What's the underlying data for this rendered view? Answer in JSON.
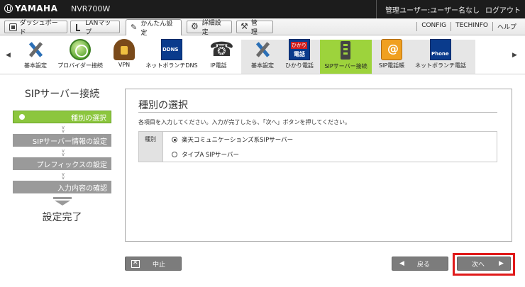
{
  "header": {
    "brand": "YAMAHA",
    "model": "NVR700W",
    "user": "管理ユーザー:ユーザー名なし",
    "logout": "ログアウト"
  },
  "tabs": [
    {
      "label": "ダッシュボード",
      "icon": "dashboard-icon"
    },
    {
      "label": "LANマップ",
      "icon": "lan-map-icon"
    },
    {
      "label": "かんたん設定",
      "icon": "wizard-icon",
      "active": true
    },
    {
      "label": "詳細設定",
      "icon": "gear-icon"
    },
    {
      "label": "管　理",
      "icon": "wrench-icon"
    }
  ],
  "tab_links": [
    "CONFIG",
    "TECHINFO",
    "ヘルプ"
  ],
  "toolbar": {
    "prev_arrow": "◀",
    "next_arrow": "▶",
    "items": [
      {
        "label": "基本設定",
        "icon": "tools-icon"
      },
      {
        "label": "プロバイダー接続",
        "icon": "globe-icon"
      },
      {
        "label": "VPN",
        "icon": "vpn-icon"
      },
      {
        "label": "ネットボランチDNS",
        "icon": "ddns-icon",
        "icon_text": "DDNS Service"
      },
      {
        "label": "IP電話",
        "icon": "phone-icon"
      },
      {
        "label": "基本設定",
        "icon": "tools-icon"
      },
      {
        "label": "ひかり電話",
        "icon": "hikari-phone-icon"
      },
      {
        "label": "SIPサーバー接続",
        "icon": "sip-server-icon",
        "selected": true
      },
      {
        "label": "SIP電話帳",
        "icon": "address-book-icon"
      },
      {
        "label": "ネットボランチ電話",
        "icon": "net-phone-icon"
      }
    ]
  },
  "sidebar": {
    "title": "SIPサーバー接続",
    "steps": [
      {
        "label": "種別の選択",
        "active": true
      },
      {
        "label": "SIPサーバー情報の設定"
      },
      {
        "label": "プレフィックスの設定"
      },
      {
        "label": "入力内容の確認"
      }
    ],
    "done": "設定完了"
  },
  "main": {
    "title": "種別の選択",
    "instruction": "各項目を入力してください。入力が完了したら、「次へ」ボタンを押してください。",
    "field_label": "種別",
    "options": [
      {
        "label": "楽天コミュニケーションズ系SIPサーバー",
        "checked": true
      },
      {
        "label": "タイプA SIPサーバー",
        "checked": false
      }
    ]
  },
  "buttons": {
    "cancel": "中止",
    "back": "戻る",
    "next": "次へ",
    "back_icon": "◀",
    "next_icon": "▶"
  },
  "colors": {
    "accent_green": "#8cc63e",
    "highlight_red": "#e01a1a"
  }
}
